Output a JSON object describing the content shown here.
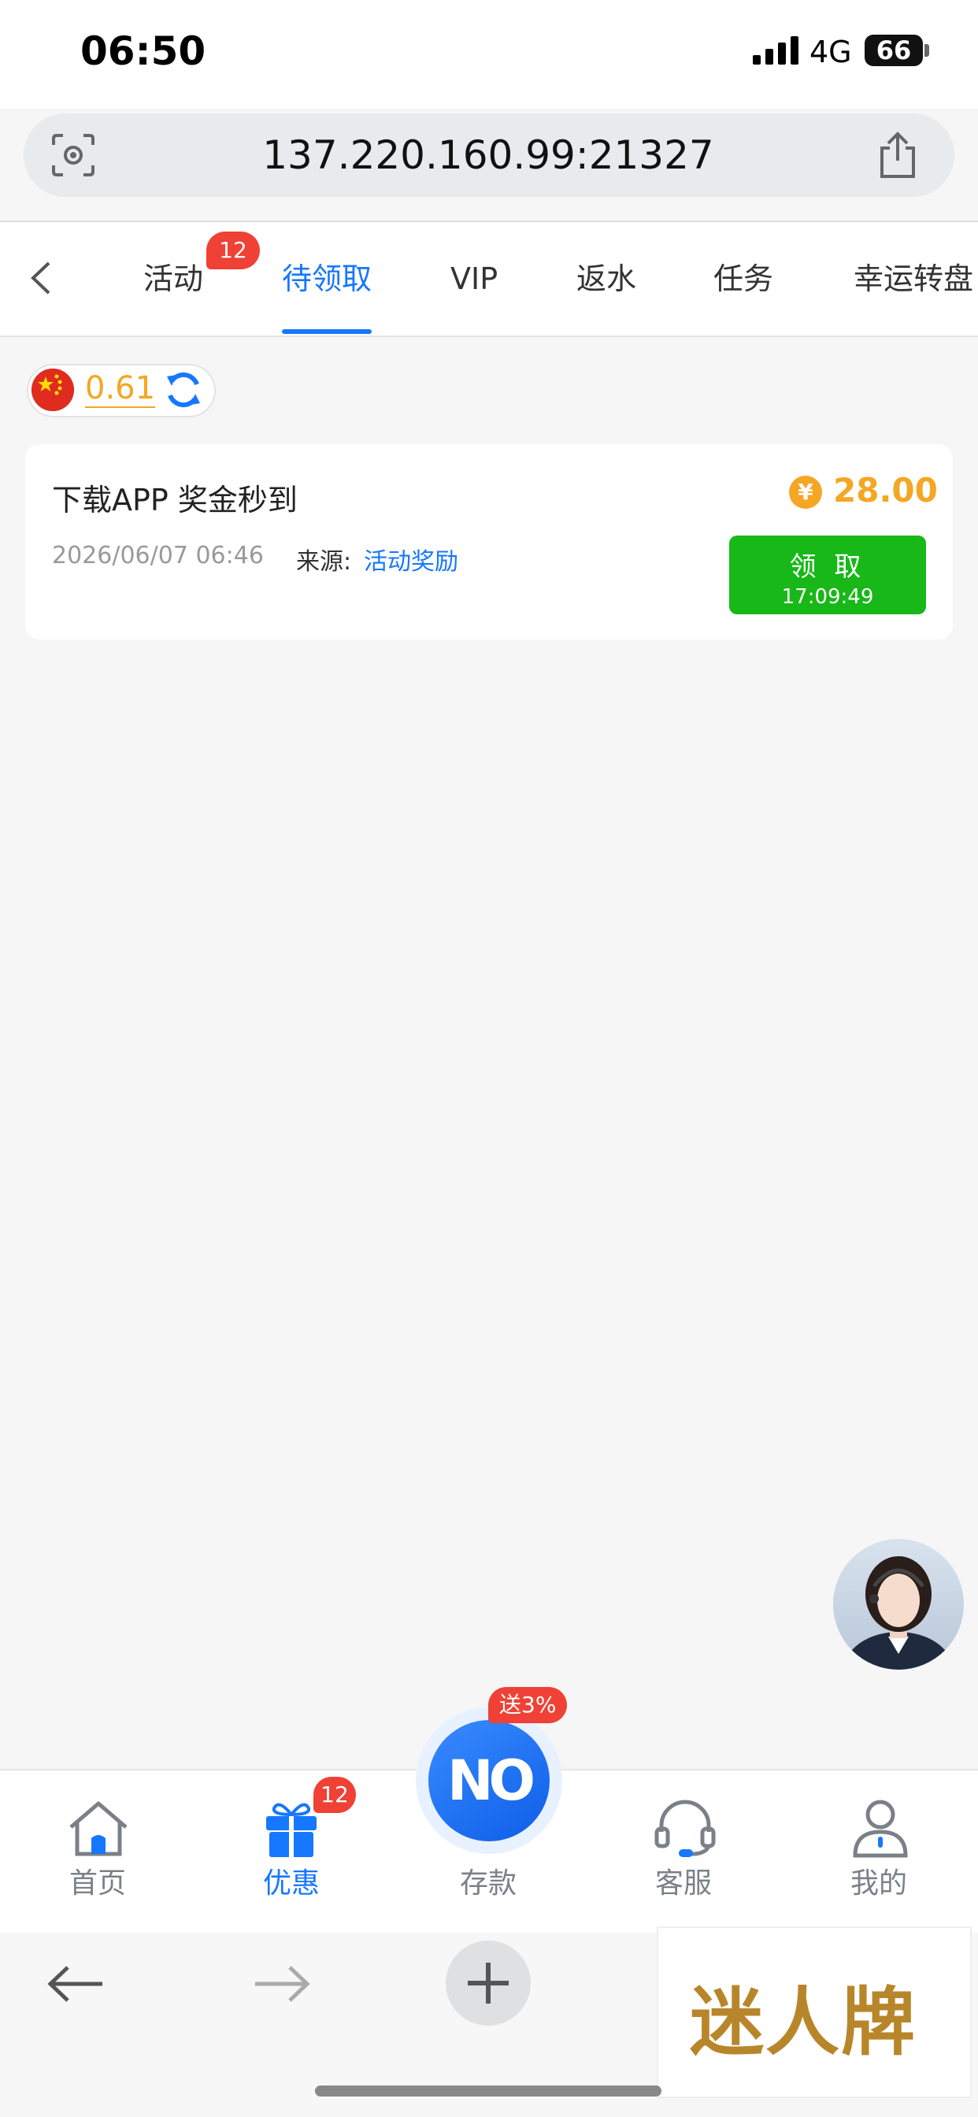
{
  "status_bar": {
    "time": "06:50",
    "network": "4G",
    "battery": "66"
  },
  "url_bar": {
    "url": "137.220.160.99:21327"
  },
  "tabs": {
    "items": [
      {
        "label": "活动",
        "badge": "12"
      },
      {
        "label": "待领取",
        "active": true
      },
      {
        "label": "VIP"
      },
      {
        "label": "返水"
      },
      {
        "label": "任务"
      },
      {
        "label": "幸运转盘"
      }
    ]
  },
  "balance": {
    "value": "0.61"
  },
  "reward_card": {
    "title": "下载APP 奖金秒到",
    "time": "2026/06/07 06:46",
    "source_label": "来源:",
    "source": "活动奖励",
    "currency_icon": "¥",
    "amount": "28.00",
    "claim_label": "领 取",
    "claim_timer": "17:09:49"
  },
  "bottom_nav": {
    "items": [
      {
        "label": "首页",
        "icon": "home-icon"
      },
      {
        "label": "优惠",
        "icon": "gift-icon",
        "badge": "12",
        "active": true
      },
      {
        "label": "存款",
        "icon": "deposit-icon",
        "badge": "送3%"
      },
      {
        "label": "客服",
        "icon": "headset-icon"
      },
      {
        "label": "我的",
        "icon": "user-icon"
      }
    ],
    "deposit_logo": "NO"
  },
  "watermark": {
    "text": "迷人牌"
  },
  "colors": {
    "accent": "#1677ff",
    "amount": "#f5a623",
    "claim": "#17b817",
    "badge": "#ef4136"
  }
}
